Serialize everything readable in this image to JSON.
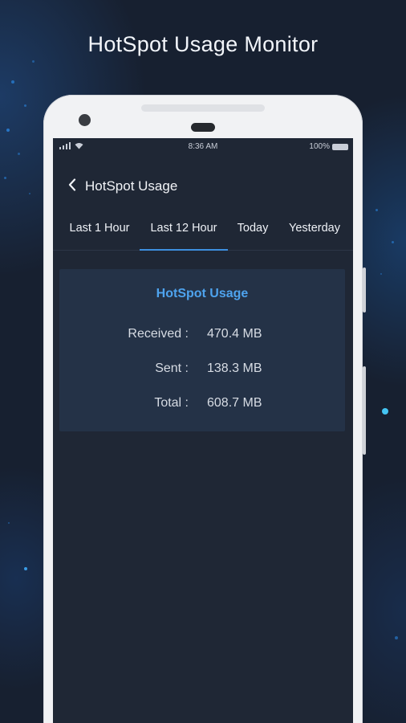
{
  "promo": {
    "title": "HotSpot Usage Monitor"
  },
  "status_bar": {
    "time": "8:36 AM",
    "battery": "100%"
  },
  "app_bar": {
    "title": "HotSpot Usage"
  },
  "tabs": [
    {
      "label": "Last 1 Hour",
      "active": false
    },
    {
      "label": "Last 12 Hour",
      "active": true
    },
    {
      "label": "Today",
      "active": false
    },
    {
      "label": "Yesterday",
      "active": false
    }
  ],
  "usage_card": {
    "title": "HotSpot Usage",
    "rows": [
      {
        "label": "Received :",
        "value": "470.4 MB"
      },
      {
        "label": "Sent :",
        "value": "138.3 MB"
      },
      {
        "label": "Total :",
        "value": "608.7 MB"
      }
    ]
  },
  "colors": {
    "background": "#172030",
    "screen": "#1f2735",
    "card": "#243247",
    "accent": "#4ea3ee",
    "tab_indicator": "#3d8fe0"
  }
}
